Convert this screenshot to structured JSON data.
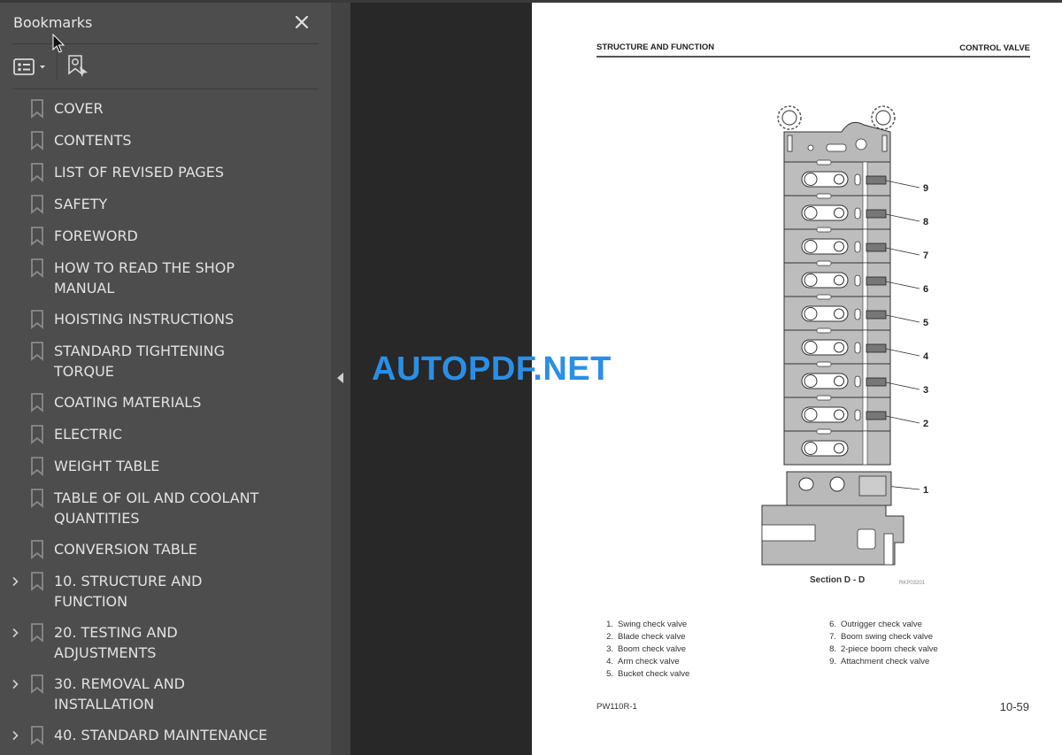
{
  "sidebar": {
    "title": "Bookmarks",
    "close_icon": "close-icon",
    "toolbar": {
      "options_icon": "list-options-icon",
      "options_dropdown_icon": "caret-down-icon",
      "find_icon": "find-current-bookmark-icon"
    },
    "items": [
      {
        "label": "COVER",
        "expandable": false
      },
      {
        "label": "CONTENTS",
        "expandable": false
      },
      {
        "label": "LIST OF REVISED PAGES",
        "expandable": false
      },
      {
        "label": "SAFETY",
        "expandable": false
      },
      {
        "label": "FOREWORD",
        "expandable": false
      },
      {
        "label": "HOW TO READ THE SHOP MANUAL",
        "expandable": false
      },
      {
        "label": "HOISTING INSTRUCTIONS",
        "expandable": false
      },
      {
        "label": "STANDARD TIGHTENING TORQUE",
        "expandable": false
      },
      {
        "label": "COATING MATERIALS",
        "expandable": false
      },
      {
        "label": "ELECTRIC",
        "expandable": false
      },
      {
        "label": "WEIGHT TABLE",
        "expandable": false
      },
      {
        "label": "TABLE OF OIL AND COOLANT QUANTITIES",
        "expandable": false
      },
      {
        "label": "CONVERSION TABLE",
        "expandable": false
      },
      {
        "label": "10. STRUCTURE AND FUNCTION",
        "expandable": true
      },
      {
        "label": "20. TESTING AND ADJUSTMENTS",
        "expandable": true
      },
      {
        "label": "30. REMOVAL AND INSTALLATION",
        "expandable": true
      },
      {
        "label": "40. STANDARD MAINTENANCE",
        "expandable": true
      }
    ]
  },
  "collapse_icon": "collapse-left-icon",
  "page": {
    "header_left": "STRUCTURE AND FUNCTION",
    "header_right": "CONTROL VALVE",
    "figure": {
      "callouts": [
        "9",
        "8",
        "7",
        "6",
        "5",
        "4",
        "3",
        "2",
        "1"
      ],
      "caption": "Section D - D",
      "code": "RKP03201"
    },
    "legend_left": [
      {
        "num": "1.",
        "text": "Swing check valve"
      },
      {
        "num": "2.",
        "text": "Blade check valve"
      },
      {
        "num": "3.",
        "text": "Boom check valve"
      },
      {
        "num": "4.",
        "text": "Arm check valve"
      },
      {
        "num": "5.",
        "text": "Bucket check valve"
      }
    ],
    "legend_right": [
      {
        "num": "6.",
        "text": "Outrigger check valve"
      },
      {
        "num": "7.",
        "text": "Boom swing check valve"
      },
      {
        "num": "8.",
        "text": "2-piece boom check valve"
      },
      {
        "num": "9.",
        "text": "Attachment check valve"
      }
    ],
    "footer_left": "PW110R-1",
    "footer_right": "10-59"
  },
  "watermark": "AUTOPDF.NET",
  "colors": {
    "sidebar_bg": "#4d4d4d",
    "viewer_bg": "#282828",
    "watermark": "#2a8fe6"
  }
}
